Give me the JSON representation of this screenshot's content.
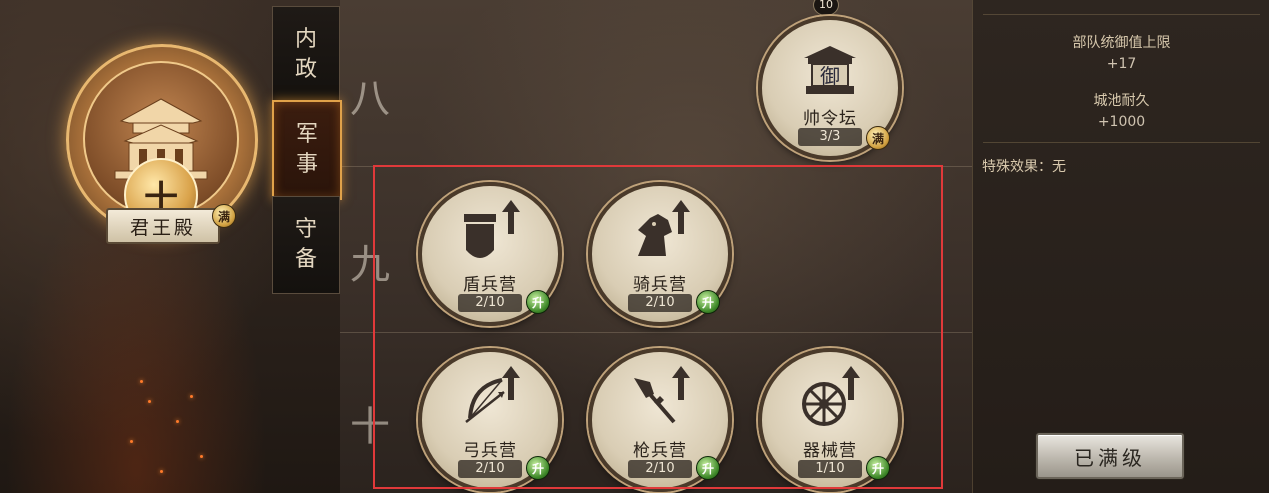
{
  "tabs": [
    {
      "label": "内政",
      "active": false
    },
    {
      "label": "军事",
      "active": true
    },
    {
      "label": "守备",
      "active": false
    }
  ],
  "main_building": {
    "name": "君王殿",
    "level": "十",
    "badge": "满"
  },
  "tiers": [
    "八",
    "九",
    "十"
  ],
  "nodes": {
    "commander": {
      "name": "帅令坛",
      "icon_text": "御",
      "count": "3/3",
      "badge": "满",
      "level_label": "10"
    },
    "shield": {
      "name": "盾兵营",
      "count": "2/10",
      "badge": "升"
    },
    "cavalry": {
      "name": "骑兵营",
      "count": "2/10",
      "badge": "升"
    },
    "archer": {
      "name": "弓兵营",
      "count": "2/10",
      "badge": "升"
    },
    "spear": {
      "name": "枪兵营",
      "count": "2/10",
      "badge": "升"
    },
    "siege": {
      "name": "器械营",
      "count": "1/10",
      "badge": "升"
    }
  },
  "right_panel": {
    "stat1_label": "部队统御值上限",
    "stat1_value": "+17",
    "stat2_label": "城池耐久",
    "stat2_value": "+1000",
    "special": "特殊效果：无",
    "button_label": "已满级"
  },
  "colors": {
    "highlight": "#e0393a",
    "active_tab_border": "#e0a24a",
    "up_badge": "#3f8a2a",
    "max_badge": "#d1a040"
  },
  "icons": {
    "shield": "shield-icon",
    "cavalry": "horse-head-icon",
    "archer": "bow-icon",
    "spear": "spear-icon",
    "siege": "wheel-icon",
    "upgrade": "arrow-up-icon"
  }
}
